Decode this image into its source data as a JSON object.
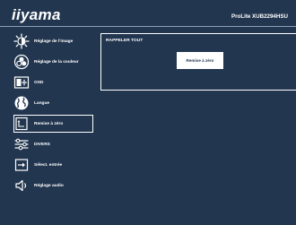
{
  "header": {
    "logo": "iiyama",
    "model": "ProLite XUB2294HSU"
  },
  "menu": {
    "items": [
      {
        "label": "Réglage de l'image",
        "icon": "brightness-icon"
      },
      {
        "label": "Réglage de la couleur",
        "icon": "color-palette-icon"
      },
      {
        "label": "OSD",
        "icon": "osd-icon"
      },
      {
        "label": "Langue",
        "icon": "globe-icon"
      },
      {
        "label": "Remise à zéro",
        "icon": "reset-icon",
        "selected": true
      },
      {
        "label": "DIVERS",
        "icon": "sliders-icon"
      },
      {
        "label": "Sélect. entrée",
        "icon": "input-select-icon"
      },
      {
        "label": "Réglage audio",
        "icon": "speaker-icon"
      }
    ]
  },
  "panel": {
    "title": "RAPPELER TOUT",
    "button_label": "Remise à zéro"
  },
  "colors": {
    "background": "#22364f",
    "foreground": "#ffffff"
  }
}
